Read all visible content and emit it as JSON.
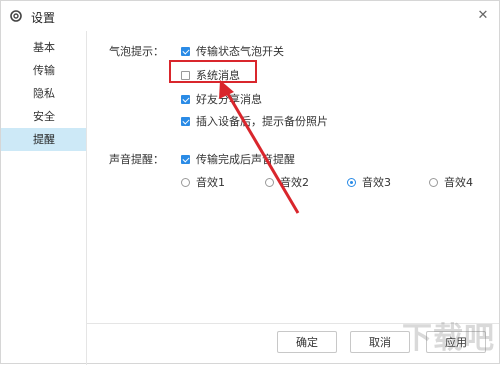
{
  "window": {
    "title": "设置",
    "close_glyph": "✕"
  },
  "sidebar": {
    "items": [
      {
        "label": "基本",
        "active": false
      },
      {
        "label": "传输",
        "active": false
      },
      {
        "label": "隐私",
        "active": false
      },
      {
        "label": "安全",
        "active": false
      },
      {
        "label": "提醒",
        "active": true
      }
    ]
  },
  "bubble": {
    "label": "气泡提示：",
    "options": [
      {
        "label": "传输状态气泡开关",
        "checked": true
      },
      {
        "label": "系统消息",
        "checked": false
      },
      {
        "label": "好友分享消息",
        "checked": true
      },
      {
        "label": "插入设备后，提示备份照片",
        "checked": true
      }
    ]
  },
  "sound": {
    "label": "声音提醒：",
    "option": {
      "label": "传输完成后声音提醒",
      "checked": true
    },
    "effects": [
      {
        "label": "音效1",
        "selected": false
      },
      {
        "label": "音效2",
        "selected": false
      },
      {
        "label": "音效3",
        "selected": true
      },
      {
        "label": "音效4",
        "selected": false
      }
    ]
  },
  "footer": {
    "ok": "确定",
    "cancel": "取消",
    "apply": "应用"
  },
  "watermark": "下载吧",
  "colors": {
    "accent": "#2a8be6",
    "annotation": "#d9262c",
    "sidebar_active": "#cde9f7"
  }
}
